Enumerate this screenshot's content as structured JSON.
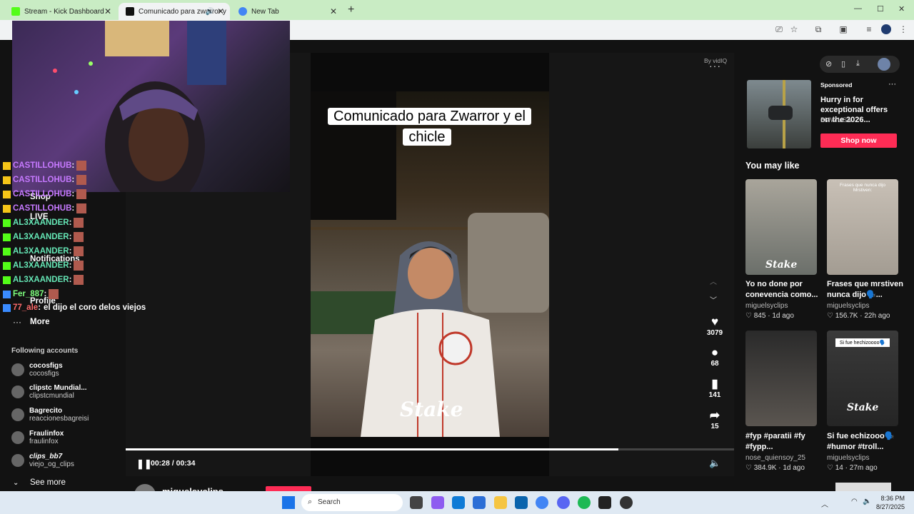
{
  "browser": {
    "tabs": [
      {
        "title": "Stream - Kick Dashboard",
        "active": false
      },
      {
        "title": "Comunicado para zwarror y",
        "active": true
      },
      {
        "title": "New Tab",
        "active": false
      }
    ],
    "new_tab": "+",
    "window_controls": [
      "—",
      "☐",
      "✕"
    ]
  },
  "video": {
    "caption": "Comunicado para Zwarror y el chicle",
    "watermark": "Stake",
    "attribution": "By vidIQ",
    "time": "00:28 / 00:34",
    "progress": 0.81
  },
  "rail": {
    "likes": "3079",
    "comments": "68",
    "saves": "141",
    "shares": "15"
  },
  "author": {
    "username": "miguelsyclips"
  },
  "chat": [
    {
      "user": "CASTILLOHUB",
      "color": "#c679ff"
    },
    {
      "user": "CASTILLOHUB",
      "color": "#c679ff"
    },
    {
      "user": "CASTILLOHUB",
      "color": "#c679ff"
    },
    {
      "user": "CASTILLOHUB",
      "color": "#c679ff"
    },
    {
      "user": "AL3XAANDER",
      "color": "#65e6b5"
    },
    {
      "user": "AL3XAANDER",
      "color": "#65e6b5"
    },
    {
      "user": "AL3XAANDER",
      "color": "#65e6b5"
    },
    {
      "user": "AL3XAANDER",
      "color": "#65e6b5"
    },
    {
      "user": "AL3XAANDER",
      "color": "#65e6b5"
    },
    {
      "user": "Fer_887",
      "color": "#7dff7d"
    },
    {
      "user": "77_ale",
      "color": "#ff6b6b",
      "message": "el dijo el coro delos viejos"
    }
  ],
  "nav": {
    "shop": "Shop",
    "live": "LIVE",
    "notifications": "Notifications",
    "profile": "Profile",
    "more": "More",
    "following_header": "Following accounts",
    "see_more": "See more"
  },
  "following": [
    {
      "name": "cocosfigs",
      "handle": "cocosfigs"
    },
    {
      "name": "clipstc Mundial...",
      "handle": "clipstcmundial"
    },
    {
      "name": "Bagrecito",
      "handle": "reaccionesbagreisi"
    },
    {
      "name": "Fraulinfox",
      "handle": "fraulinfox"
    },
    {
      "name": "clips_bb7",
      "handle": "viejo_og_clips"
    }
  ],
  "ad": {
    "label": "Sponsored",
    "title": "Hurry in for exceptional offers on the 2026...",
    "brand": "BMW USA",
    "cta": "Shop now"
  },
  "recommend": {
    "header": "You may like",
    "items": [
      {
        "title": "Yo no done por conevencia como...",
        "user": "miguelsyclips",
        "likes": "845",
        "age": "1d ago",
        "thumb_text": "Stake"
      },
      {
        "title": "Frases que mrstiven nunca dijo🗣️...",
        "user": "miguelsyclips",
        "likes": "156.7K",
        "age": "22h ago",
        "thumb_text": "Frases que nunca dijo Mrstiven:"
      },
      {
        "title": "#fyp #paratii #fy #fypp...",
        "user": "nose_quiensoy_25",
        "likes": "384.9K",
        "age": "1d ago",
        "thumb_text": ""
      },
      {
        "title": "Si fue echizooo🗣️ #humor #troll...",
        "user": "miguelsyclips",
        "likes": "14",
        "age": "27m ago",
        "thumb_text": "Si fue hechizoooo🗣️"
      }
    ]
  },
  "taskbar": {
    "search": "Search",
    "time": "8:36 PM",
    "date": "8/27/2025"
  }
}
